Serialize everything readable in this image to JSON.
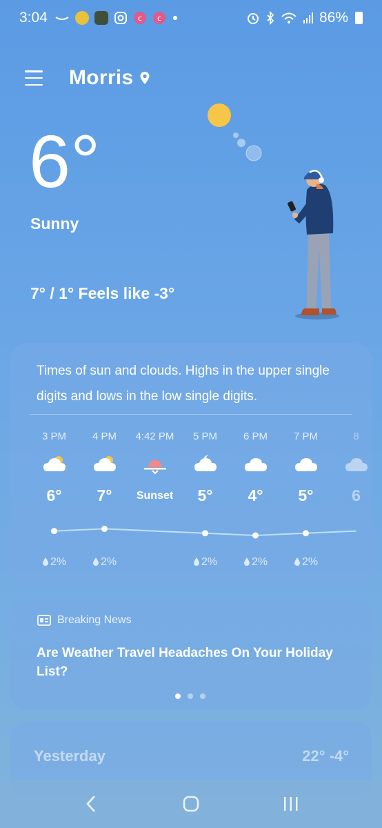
{
  "status_bar": {
    "time": "3:04",
    "battery": "86%",
    "icons": [
      "amazon-icon",
      "coins-icon",
      "app-icon",
      "instagram-icon",
      "mcdonalds-icon",
      "mcdonalds-icon",
      "dot-icon",
      "alarm-icon",
      "bluetooth-icon",
      "wifi-icon",
      "signal-icon",
      "battery-icon"
    ]
  },
  "header": {
    "city": "Morris"
  },
  "current": {
    "temp": "6°",
    "condition": "Sunny",
    "hi_lo_feels": "7° / 1° Feels like -3°"
  },
  "forecast": {
    "summary": "Times of sun and clouds. Highs in the upper single digits and lows in the low single digits.",
    "hours": [
      {
        "time": "3 PM",
        "icon": "partly-sunny-icon",
        "temp": "6°",
        "precip": "2%"
      },
      {
        "time": "4 PM",
        "icon": "partly-sunny-icon",
        "temp": "7°",
        "precip": "2%"
      },
      {
        "time": "4:42 PM",
        "icon": "sunset-icon",
        "temp": "Sunset",
        "precip": ""
      },
      {
        "time": "5 PM",
        "icon": "cloudy-night-icon",
        "temp": "5°",
        "precip": "2%"
      },
      {
        "time": "6 PM",
        "icon": "cloudy-icon",
        "temp": "4°",
        "precip": "2%"
      },
      {
        "time": "7 PM",
        "icon": "cloudy-icon",
        "temp": "5°",
        "precip": "2%"
      },
      {
        "time": "8",
        "icon": "cloudy-icon",
        "temp": "6",
        "precip": ""
      }
    ]
  },
  "news": {
    "header": "Breaking News",
    "title": "Are Weather Travel Headaches On Your Holiday List?",
    "page": 1,
    "pages": 3
  },
  "yesterday": {
    "label": "Yesterday",
    "temps": "22°  -4°"
  },
  "colors": {
    "sun": "#f7c548",
    "sunset": "#f08a8a",
    "jacket": "#1f3f73",
    "pants": "#9aa3b5"
  }
}
